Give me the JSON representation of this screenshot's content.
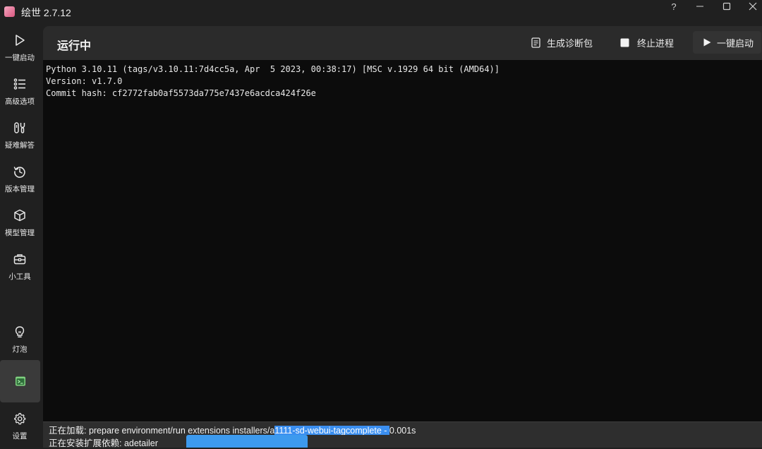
{
  "window": {
    "title": "绘世 2.7.12",
    "controls": [
      "?",
      "minimize-icon",
      "maximize-icon",
      "close-icon"
    ],
    "help_label": "?"
  },
  "sidebar": {
    "items": [
      {
        "label": "一键启动",
        "icon": "play-icon"
      },
      {
        "label": "高级选项",
        "icon": "list-icon"
      },
      {
        "label": "疑难解答",
        "icon": "tools-icon"
      },
      {
        "label": "版本管理",
        "icon": "history-icon"
      },
      {
        "label": "模型管理",
        "icon": "cube-icon"
      },
      {
        "label": "小工具",
        "icon": "toolbox-icon"
      },
      {
        "label": "灯泡",
        "icon": "lightbulb-icon"
      },
      {
        "label": "",
        "icon": "console-icon",
        "active": true
      },
      {
        "label": "设置",
        "icon": "gear-icon"
      }
    ]
  },
  "header": {
    "title": "运行中",
    "diag_label": "生成诊断包",
    "stop_label": "终止进程",
    "start_label": "一键启动"
  },
  "terminal": {
    "lines": [
      "Python 3.10.11 (tags/v3.10.11:7d4cc5a, Apr  5 2023, 00:38:17) [MSC v.1929 64 bit (AMD64)]",
      "Version: v1.7.0",
      "Commit hash: cf2772fab0af5573da775e7437e6acdca424f26e"
    ]
  },
  "status": {
    "line1_prefix": "正在加载: prepare environment/run extensions installers/a",
    "line1_highlight": "1111-sd-webui-tagcomplete - ",
    "line1_suffix": "0.001s",
    "line2": "正在安装扩展依赖: adetailer",
    "progress_fraction": 0.17
  },
  "colors": {
    "accent": "#3b8ff0",
    "background": "#202020",
    "panel": "#2b2b2b",
    "terminal_bg": "#0c0c0c"
  }
}
